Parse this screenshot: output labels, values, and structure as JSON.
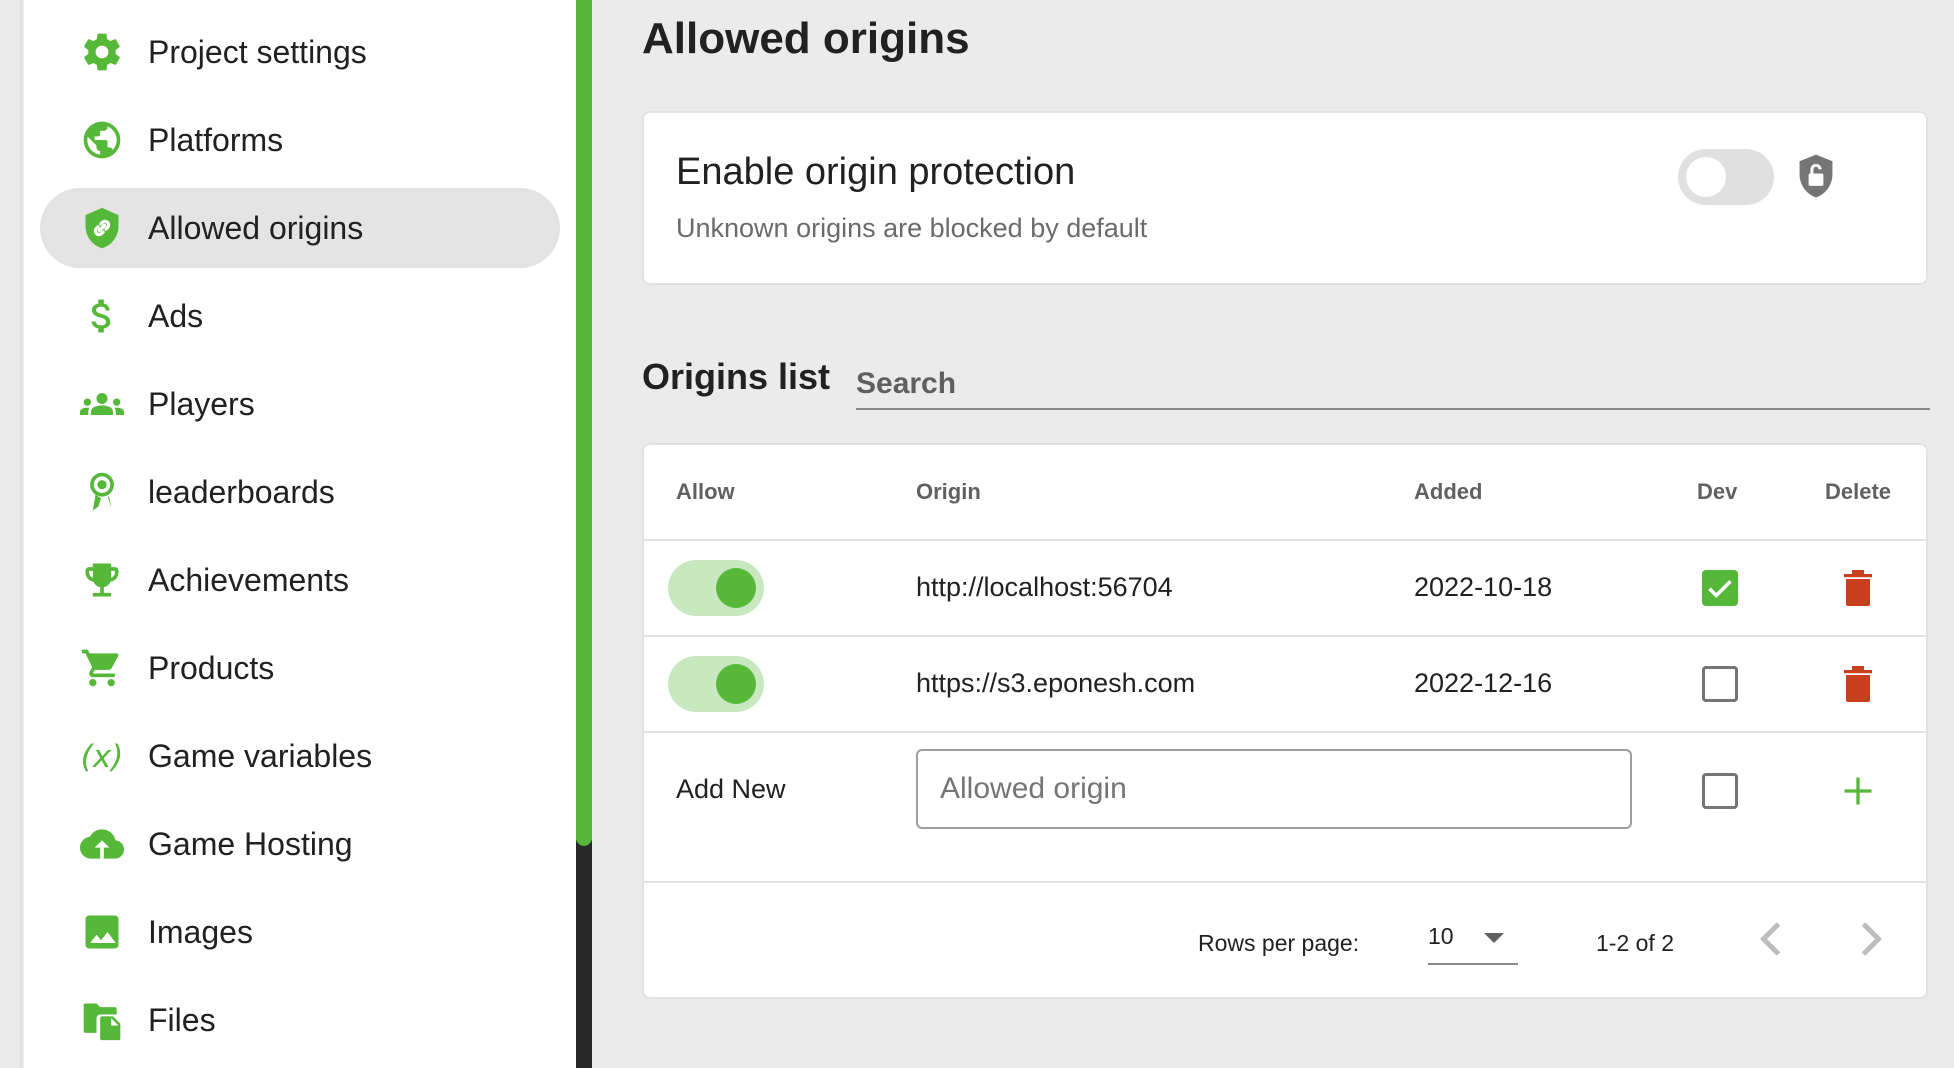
{
  "sidebar": {
    "items": [
      {
        "label": "Project settings",
        "icon": "gear-icon",
        "active": false
      },
      {
        "label": "Platforms",
        "icon": "globe-icon",
        "active": false
      },
      {
        "label": "Allowed origins",
        "icon": "shield-link-icon",
        "active": true
      },
      {
        "label": "Ads",
        "icon": "dollar-icon",
        "active": false
      },
      {
        "label": "Players",
        "icon": "group-icon",
        "active": false
      },
      {
        "label": "leaderboards",
        "icon": "award-ribbon-icon",
        "active": false
      },
      {
        "label": "Achievements",
        "icon": "trophy-icon",
        "active": false
      },
      {
        "label": "Products",
        "icon": "cart-icon",
        "active": false
      },
      {
        "label": "Game variables",
        "icon": "variable-x-icon",
        "active": false
      },
      {
        "label": "Game Hosting",
        "icon": "cloud-upload-icon",
        "active": false
      },
      {
        "label": "Images",
        "icon": "image-icon",
        "active": false
      },
      {
        "label": "Files",
        "icon": "files-icon",
        "active": false
      }
    ]
  },
  "colors": {
    "accent": "#55b838",
    "danger": "#c9401f",
    "toggle_on_track": "#c8e8c0",
    "toggle_off_track": "#e0e0e0",
    "background": "#ebebeb"
  },
  "main": {
    "title": "Allowed origins",
    "protection": {
      "title": "Enable origin protection",
      "subtitle": "Unknown origins are blocked by default",
      "enabled": false,
      "lock_icon": "shield-unlock-icon"
    },
    "list": {
      "title": "Origins list",
      "search_placeholder": "Search",
      "columns": [
        "Allow",
        "Origin",
        "Added",
        "Dev",
        "Delete"
      ],
      "rows": [
        {
          "allow": true,
          "origin": "http://localhost:56704",
          "added": "2022-10-18",
          "dev": true
        },
        {
          "allow": true,
          "origin": "https://s3.eponesh.com",
          "added": "2022-12-16",
          "dev": false
        }
      ],
      "add_new": {
        "label": "Add New",
        "placeholder": "Allowed origin",
        "value": "",
        "dev": false
      },
      "pagination": {
        "rows_per_page_label": "Rows per page:",
        "rows_per_page": "10",
        "range": "1-2 of 2"
      }
    }
  }
}
